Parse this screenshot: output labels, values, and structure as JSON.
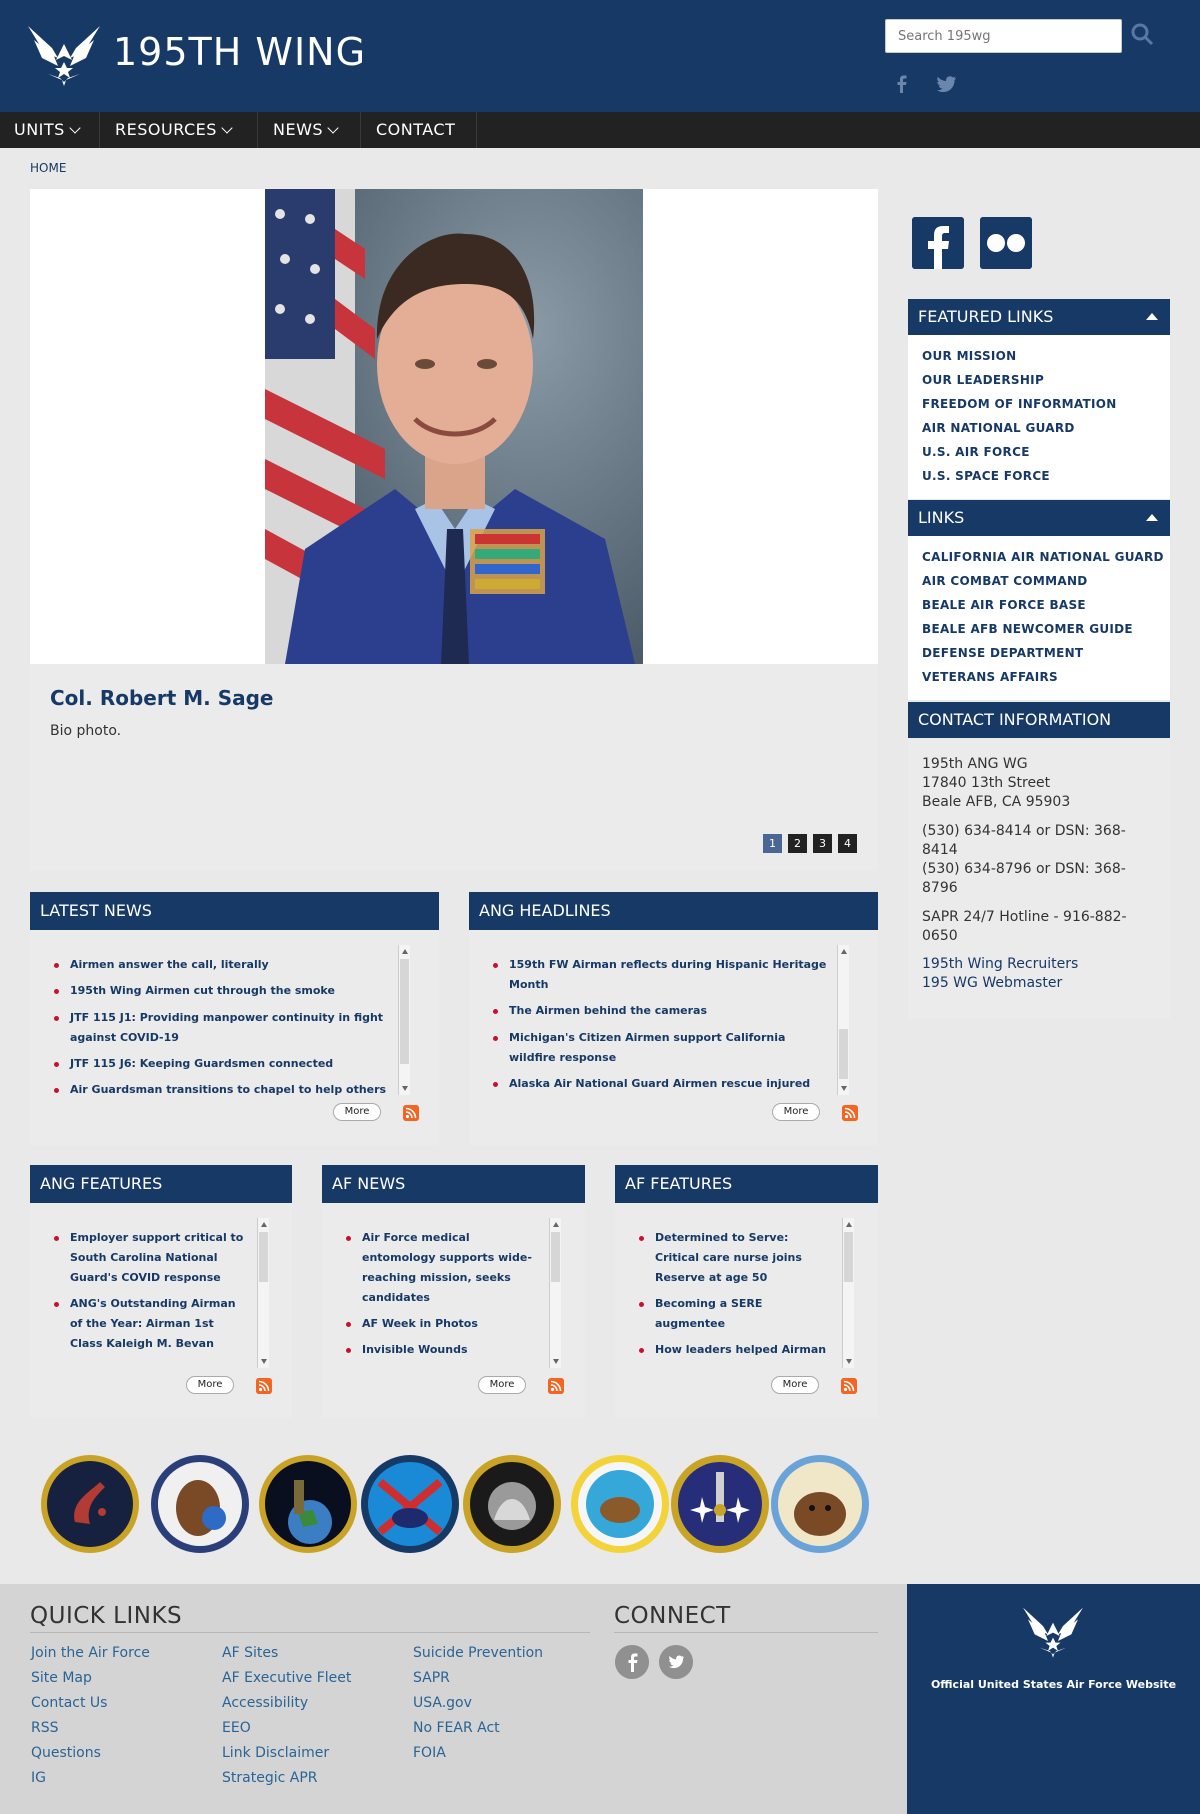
{
  "header": {
    "site_title": "195TH WING",
    "search_placeholder": "Search 195wg"
  },
  "nav": {
    "items": [
      {
        "label": "UNITS",
        "has_dropdown": true
      },
      {
        "label": "RESOURCES",
        "has_dropdown": true
      },
      {
        "label": "NEWS",
        "has_dropdown": true
      },
      {
        "label": "CONTACT",
        "has_dropdown": false
      }
    ]
  },
  "breadcrumb": "HOME",
  "hero": {
    "title": "Col. Robert M. Sage",
    "caption": "Bio photo.",
    "pages": [
      "1",
      "2",
      "3",
      "4"
    ],
    "active_page": "1"
  },
  "sidebar": {
    "featured_links": {
      "title": "FEATURED LINKS",
      "items": [
        "OUR MISSION",
        "OUR LEADERSHIP",
        "FREEDOM OF INFORMATION",
        "AIR NATIONAL GUARD",
        "U.S. AIR FORCE",
        "U.S. SPACE FORCE"
      ]
    },
    "links": {
      "title": "LINKS",
      "items": [
        "CALIFORNIA AIR NATIONAL GUARD",
        "AIR COMBAT COMMAND",
        "BEALE AIR FORCE BASE",
        "BEALE AFB NEWCOMER GUIDE",
        "DEFENSE DEPARTMENT",
        "VETERANS AFFAIRS"
      ]
    },
    "contact": {
      "title": "CONTACT INFORMATION",
      "address_1": "195th ANG WG",
      "address_2": "17840 13th Street",
      "address_3": "Beale AFB, CA  95903",
      "phone_1a": "(530) 634-8414 or DSN: 368-",
      "phone_1b": "8414",
      "phone_2a": "(530) 634-8796 or DSN: 368-",
      "phone_2b": "8796",
      "hotline_a": "SAPR 24/7 Hotline - 916-882-",
      "hotline_b": "0650",
      "link_recruiters": "195th Wing Recruiters",
      "link_webmaster": "195 WG Webmaster"
    }
  },
  "panels": {
    "latest_news": {
      "title": "LATEST NEWS",
      "items": [
        "Airmen answer the call, literally",
        "195th Wing Airmen cut through the smoke",
        "JTF 115 J1: Providing manpower continuity in fight",
        "against COVID-19",
        "JTF 115 J6: Keeping Guardsmen connected",
        "Air Guardsman transitions to chapel to help others"
      ],
      "more": "More"
    },
    "ang_headlines": {
      "title": "ANG HEADLINES",
      "items": [
        "159th FW Airman reflects during Hispanic Heritage",
        "Month",
        "The Airmen behind the cameras",
        "Michigan's Citizen Airmen support California",
        "wildfire response",
        "Alaska Air National Guard Airmen rescue injured"
      ],
      "more": "More"
    },
    "ang_features": {
      "title": "ANG FEATURES",
      "items": [
        "Employer support critical to",
        "South Carolina National",
        "Guard's COVID response",
        "ANG's Outstanding Airman",
        "of the Year: Airman 1st",
        "Class Kaleigh M. Bevan"
      ],
      "more": "More"
    },
    "af_news": {
      "title": "AF NEWS",
      "items": [
        "Air Force medical",
        "entomology supports wide-",
        "reaching mission, seeks",
        "candidates",
        "AF Week in Photos",
        "Invisible Wounds"
      ],
      "more": "More"
    },
    "af_features": {
      "title": "AF FEATURES",
      "items": [
        "Determined to Serve:",
        "Critical care nurse joins",
        "Reserve at age 50",
        "Becoming a SERE",
        "augmentee",
        "How leaders helped Airman"
      ],
      "more": "More"
    }
  },
  "badges": [
    "195th Wing HQ",
    "216th Combat Communications",
    "216th Space Operations",
    "234th Intelligence Squadron",
    "148th Space Control Squadron",
    "234th Intelligence Squadron Rough and Ready",
    "234th Intelligence SE",
    "222nd Mission Support"
  ],
  "footer": {
    "quick_links_title": "QUICK LINKS",
    "connect_title": "CONNECT",
    "col1": [
      "Join the Air Force",
      "Site Map",
      "Contact Us",
      "RSS",
      "Questions",
      "IG"
    ],
    "col2": [
      "AF Sites",
      "AF Executive Fleet",
      "Accessibility",
      "EEO",
      "Link Disclaimer",
      "Strategic APR"
    ],
    "col3": [
      "Suicide Prevention",
      "SAPR",
      "USA.gov",
      "No FEAR Act",
      "FOIA"
    ],
    "af_site_label": "Official United States Air Force Website"
  },
  "colors": {
    "brand_blue": "#173966",
    "nav_dark": "#222222",
    "bullet_red": "#c8102e",
    "link_blue": "#2a6496"
  }
}
